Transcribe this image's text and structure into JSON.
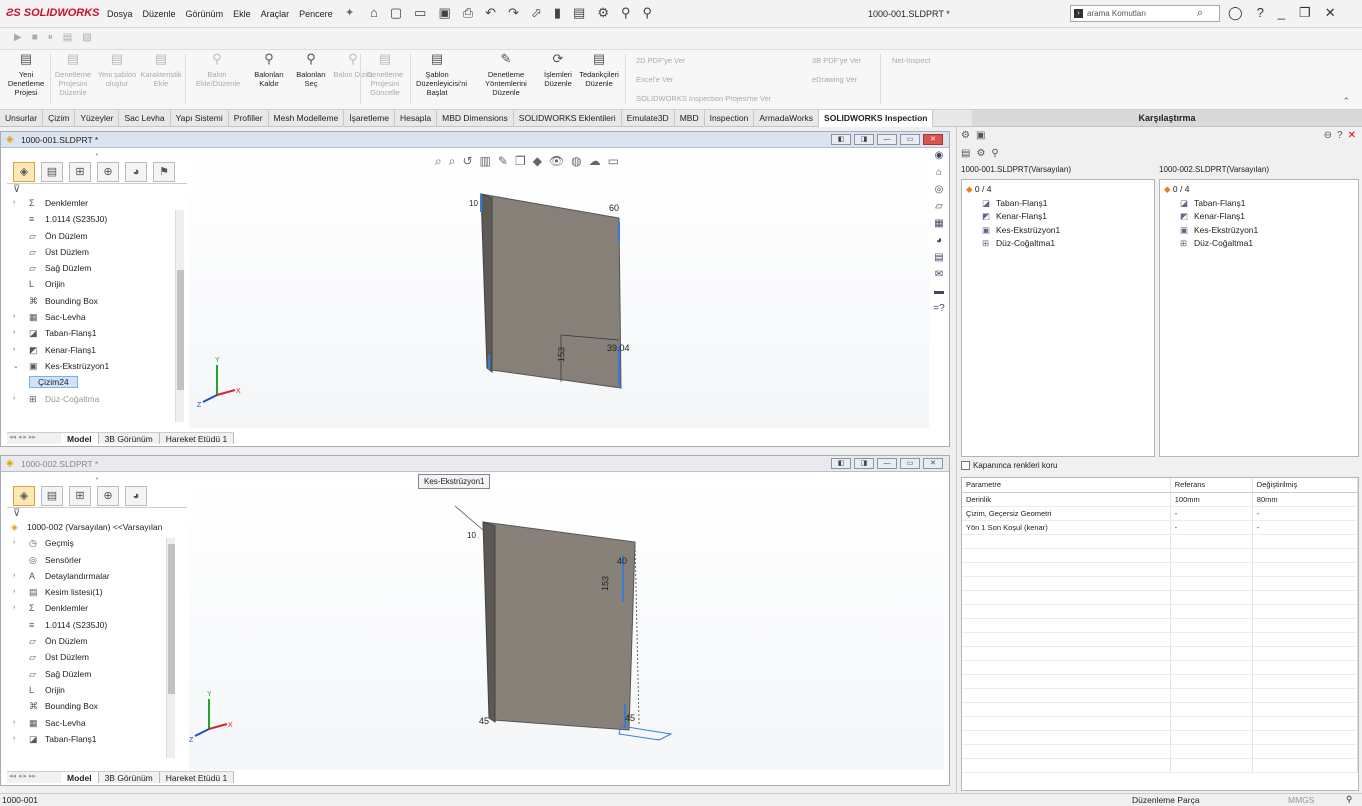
{
  "app": {
    "logo": "SOLIDWORKS",
    "doc_title": "1000-001.SLDPRT *",
    "search_placeholder": "arama Komutları"
  },
  "menu": [
    "Dosya",
    "Düzenle",
    "Görünüm",
    "Ekle",
    "Araçlar",
    "Pencere"
  ],
  "ribbon": {
    "buttons": [
      {
        "label": "Yeni Denetleme Projesi",
        "enabled": true
      },
      {
        "label": "Denetleme Projesini Düzenle",
        "enabled": false
      },
      {
        "label": "Yeni şablon oluştur",
        "enabled": false
      },
      {
        "label": "Karakteristik Ekle",
        "enabled": false
      },
      {
        "label": "Balon Ekle/Düzenle",
        "enabled": false
      },
      {
        "label": "Balonları Kaldır",
        "enabled": true
      },
      {
        "label": "Balonları Seç",
        "enabled": true
      },
      {
        "label": "Balon Dizisi",
        "enabled": false
      },
      {
        "label": "Denetleme Projesini Güncelle",
        "enabled": false
      },
      {
        "label": "Şablon Düzenleyicisi'ni Başlat",
        "enabled": true
      },
      {
        "label": "Denetleme Yöntemlerini Düzenle",
        "enabled": true
      },
      {
        "label": "İşlemleri Düzenle",
        "enabled": true
      },
      {
        "label": "Tedarikçileri Düzenle",
        "enabled": true
      }
    ],
    "small": [
      "2D PDF'ye Ver",
      "Excel'e Ver",
      "SOLIDWORKS Inspection Projesi'ne Ver",
      "3B PDF'ye Ver",
      "eDrawing Ver",
      "Net-Inspect"
    ]
  },
  "tabs": [
    "Unsurlar",
    "Çizim",
    "Yüzeyler",
    "Sac Levha",
    "Yapı Sistemi",
    "Profiller",
    "Mesh Modelleme",
    "İşaretleme",
    "Hesapla",
    "MBD Dimensions",
    "SOLIDWORKS Eklentileri",
    "Emulate3D",
    "MBD",
    "Inspection",
    "ArmadaWorks",
    "SOLIDWORKS Inspection"
  ],
  "compare_title": "Karşılaştırma",
  "doc1": {
    "title": "1000-001.SLDPRT *",
    "tree": [
      {
        "label": "Denklemler",
        "arrow": "›",
        "icon": "Σ"
      },
      {
        "label": "1.0114 (S235J0)",
        "arrow": "",
        "icon": "≡"
      },
      {
        "label": "Ön Düzlem",
        "arrow": "",
        "icon": "▱"
      },
      {
        "label": "Üst Düzlem",
        "arrow": "",
        "icon": "▱"
      },
      {
        "label": "Sağ Düzlem",
        "arrow": "",
        "icon": "▱"
      },
      {
        "label": "Orijin",
        "arrow": "",
        "icon": "L"
      },
      {
        "label": "Bounding Box",
        "arrow": "",
        "icon": "⌘"
      },
      {
        "label": "Sac-Levha",
        "arrow": "›",
        "icon": "▦"
      },
      {
        "label": "Taban-Flanş1",
        "arrow": "›",
        "icon": "◪"
      },
      {
        "label": "Kenar-Flanş1",
        "arrow": "›",
        "icon": "◩"
      },
      {
        "label": "Kes-Ekstrüzyon1",
        "arrow": "⌄",
        "icon": "▣"
      }
    ],
    "selected": "Çizim24",
    "last": "Düz-Coğaltma",
    "bottom_tabs": [
      "Model",
      "3B Görünüm",
      "Hareket Etüdü 1"
    ],
    "dims": [
      "60",
      "153",
      "39.04"
    ]
  },
  "doc2": {
    "title": "1000-002.SLDPRT *",
    "root": "1000-002 (Varsayılan) <<Varsayılan",
    "tree": [
      {
        "label": "Geçmiş",
        "arrow": "›",
        "icon": "◷"
      },
      {
        "label": "Sensörler",
        "arrow": "",
        "icon": "◎"
      },
      {
        "label": "Detaylandırmalar",
        "arrow": "›",
        "icon": "A"
      },
      {
        "label": "Kesim listesi(1)",
        "arrow": "›",
        "icon": "▤"
      },
      {
        "label": "Denklemler",
        "arrow": "›",
        "icon": "Σ"
      },
      {
        "label": "1.0114 (S235J0)",
        "arrow": "",
        "icon": "≡"
      },
      {
        "label": "Ön Düzlem",
        "arrow": "",
        "icon": "▱"
      },
      {
        "label": "Üst Düzlem",
        "arrow": "",
        "icon": "▱"
      },
      {
        "label": "Sağ Düzlem",
        "arrow": "",
        "icon": "▱"
      },
      {
        "label": "Orijin",
        "arrow": "",
        "icon": "L"
      },
      {
        "label": "Bounding Box",
        "arrow": "",
        "icon": "⌘"
      },
      {
        "label": "Sac-Levha",
        "arrow": "›",
        "icon": "▦"
      },
      {
        "label": "Taban-Flanş1",
        "arrow": "›",
        "icon": "◪"
      }
    ],
    "bottom_tabs": [
      "Model",
      "3B Görünüm",
      "Hareket Etüdü 1"
    ],
    "tooltip": "Kes-Ekstrüzyon1",
    "dims": [
      "153",
      "40",
      "45"
    ]
  },
  "compare": {
    "left_header": "1000-001.SLDPRT(Varsayılan)",
    "right_header": "1000-002.SLDPRT(Varsayılan)",
    "count": "0 / 4",
    "features": [
      "Taban-Flanş1",
      "Kenar-Flanş1",
      "Kes-Ekstrüzyon1",
      "Düz-Coğaltma1"
    ],
    "checkbox_label": "Kapanınca renkleri koru",
    "table_headers": [
      "Parametre",
      "Referans",
      "Değiştirilmiş"
    ],
    "rows": [
      [
        "Derinlik",
        "100mm",
        "80mm"
      ],
      [
        "Çizim, Geçersiz Geometri",
        "-",
        "-"
      ],
      [
        "Yön 1 Son Koşul (kenar)",
        "-",
        "-"
      ]
    ]
  },
  "status": {
    "left": "1000-001",
    "mode": "Düzenleme Parça",
    "units": "MMGS"
  }
}
